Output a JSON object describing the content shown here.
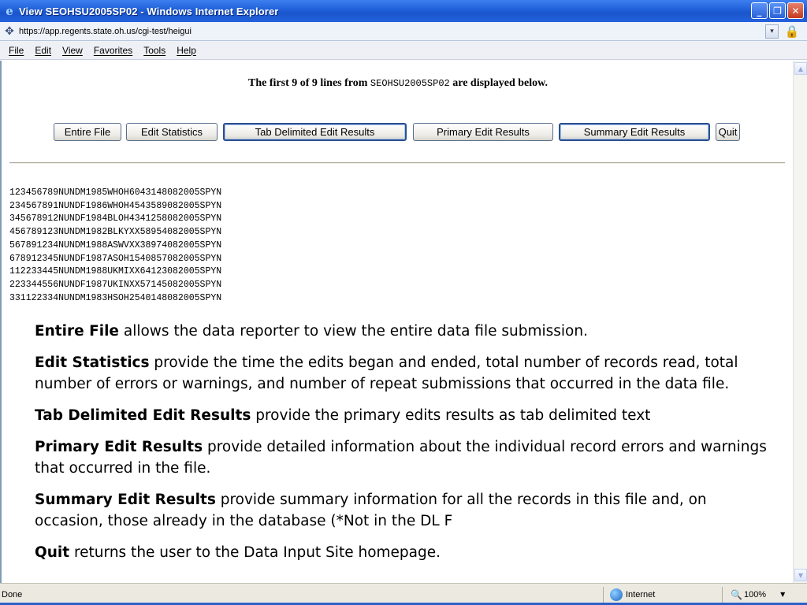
{
  "window": {
    "title": "View SEOHSU2005SP02 - Windows Internet Explorer",
    "minimize_glyph": "_",
    "restore_glyph": "❐",
    "close_glyph": "✕"
  },
  "address": {
    "url": "https://app.regents.state.oh.us/cgi-test/heigui",
    "dropdown_glyph": "▾"
  },
  "menu": [
    "File",
    "Edit",
    "View",
    "Favorites",
    "Tools",
    "Help"
  ],
  "page": {
    "heading_prefix": "The first 9 of 9 lines from",
    "heading_file": "SEOHSU2005SP02",
    "heading_suffix": "are displayed below.",
    "buttons": {
      "entire_file": "Entire File",
      "edit_statistics": "Edit Statistics",
      "tab_delimited": "Tab Delimited Edit Results",
      "primary": "Primary Edit Results",
      "summary": "Summary Edit Results",
      "quit": "Quit"
    },
    "lines": [
      "123456789NUNDM1985WHOH6043148082005SPYN",
      "234567891NUNDF1986WHOH4543589082005SPYN",
      "345678912NUNDF1984BLOH4341258082005SPYN",
      "456789123NUNDM1982BLKYXX58954082005SPYN",
      "567891234NUNDM1988ASWVXX38974082005SPYN",
      "678912345NUNDF1987ASOH1540857082005SPYN",
      "112233445NUNDM1988UKMIXX64123082005SPYN",
      "223344556NUNDF1987UKINXX57145082005SPYN",
      "331122334NUNDM1983HSOH2540148082005SPYN"
    ]
  },
  "descriptions": [
    {
      "term": "Entire File",
      "text": " allows the data reporter to view the entire data file submission."
    },
    {
      "term": "Edit Statistics",
      "text": " provide the time the edits began and ended, total number of records read, total number of errors or warnings,  and number of repeat submissions that occurred in the data file."
    },
    {
      "term": "Tab Delimited Edit Results",
      "text": " provide the primary edits results as tab delimited text"
    },
    {
      "term": "Primary Edit Results",
      "text": " provide detailed information about the individual record errors and warnings that occurred in the file."
    },
    {
      "term": "Summary Edit Results",
      "text": " provide summary information for all the records in this file and, on occasion, those already in the database (*Not in the DL F"
    },
    {
      "term": "Quit",
      "text": " returns the user to the Data Input Site homepage."
    }
  ],
  "status": {
    "left": "Done",
    "zone": "Internet",
    "zoom": "100%"
  },
  "icons": {
    "browser": "ie-logo-icon",
    "site": "site-icon",
    "lock": "lock-icon",
    "globe": "globe-icon",
    "zoom": "magnifier-icon"
  }
}
